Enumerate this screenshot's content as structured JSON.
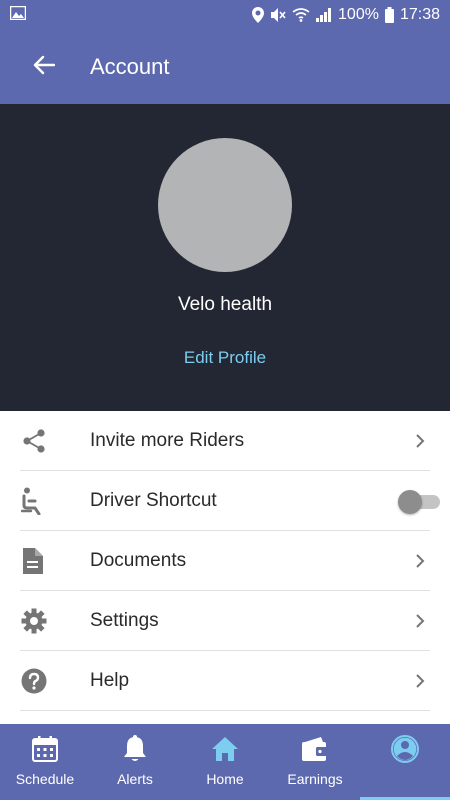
{
  "status_bar": {
    "battery": "100%",
    "time": "17:38",
    "icons": [
      "image-icon",
      "location-icon",
      "mute-icon",
      "wifi-icon",
      "signal-icon",
      "battery-icon"
    ]
  },
  "app_bar": {
    "title": "Account",
    "back_icon": "arrow-left-icon"
  },
  "profile": {
    "name": "Velo health",
    "edit_label": "Edit Profile"
  },
  "menu": {
    "items": [
      {
        "label": "Invite more Riders",
        "icon": "share-icon",
        "trailing": "chevron"
      },
      {
        "label": "Driver Shortcut",
        "icon": "seat-icon",
        "trailing": "toggle",
        "toggle_on": false
      },
      {
        "label": "Documents",
        "icon": "document-icon",
        "trailing": "chevron"
      },
      {
        "label": "Settings",
        "icon": "gear-icon",
        "trailing": "chevron"
      },
      {
        "label": "Help",
        "icon": "help-icon",
        "trailing": "chevron"
      }
    ]
  },
  "bottom_nav": {
    "items": [
      {
        "label": "Schedule",
        "icon": "calendar-icon"
      },
      {
        "label": "Alerts",
        "icon": "bell-icon"
      },
      {
        "label": "Home",
        "icon": "home-icon"
      },
      {
        "label": "Earnings",
        "icon": "wallet-icon"
      },
      {
        "label": "",
        "icon": "account-icon",
        "selected": true
      }
    ]
  },
  "colors": {
    "primary": "#5d69ae",
    "header_dark": "#232733",
    "accent": "#7ccdf0",
    "icon_gray": "#757575"
  }
}
